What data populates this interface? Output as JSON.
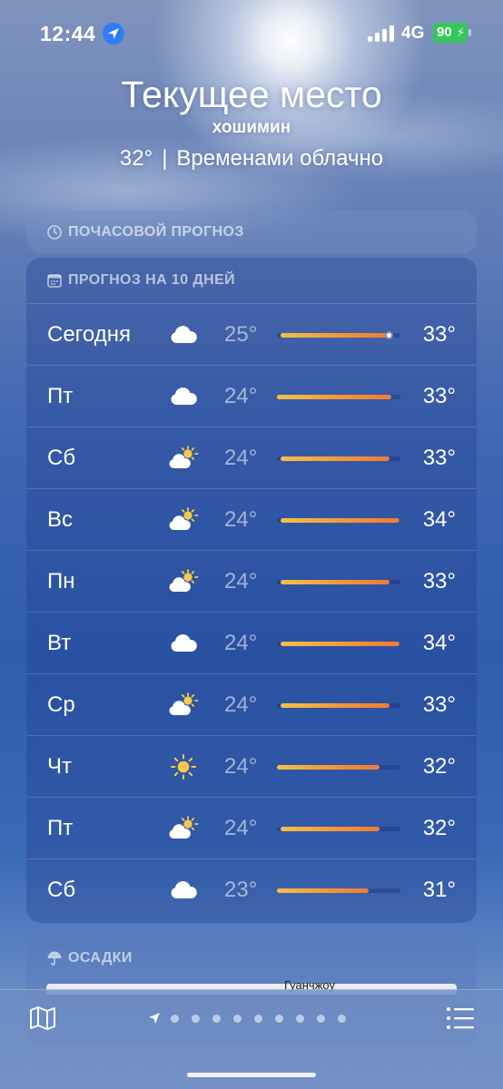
{
  "status_bar": {
    "time": "12:44",
    "network": "4G",
    "battery": "90",
    "battery_color": "#34c759"
  },
  "header": {
    "title": "Текущее место",
    "city": "хошимин",
    "temperature": "32°",
    "separator": "|",
    "condition": "Временами облачно"
  },
  "hourly_card": {
    "label": "ПОЧАСОВОЙ ПРОГНОЗ",
    "icon": "clock-icon"
  },
  "forecast_card": {
    "label": "ПРОГНОЗ НА 10 ДНЕЙ",
    "icon": "calendar-icon",
    "days": [
      {
        "day": "Сегодня",
        "icon": "cloud-icon",
        "low": "25°",
        "high": "33°",
        "range_start": 0.03,
        "range_end": 0.92,
        "current": 0.8
      },
      {
        "day": "Пт",
        "icon": "cloud-icon",
        "low": "24°",
        "high": "33°",
        "range_start": 0.0,
        "range_end": 0.93
      },
      {
        "day": "Сб",
        "icon": "partly-sunny-icon",
        "low": "24°",
        "high": "33°",
        "range_start": 0.03,
        "range_end": 0.91
      },
      {
        "day": "Вс",
        "icon": "partly-sunny-icon",
        "low": "24°",
        "high": "34°",
        "range_start": 0.03,
        "range_end": 0.99
      },
      {
        "day": "Пн",
        "icon": "partly-sunny-icon",
        "low": "24°",
        "high": "33°",
        "range_start": 0.03,
        "range_end": 0.91
      },
      {
        "day": "Вт",
        "icon": "cloud-icon",
        "low": "24°",
        "high": "34°",
        "range_start": 0.03,
        "range_end": 0.99
      },
      {
        "day": "Ср",
        "icon": "partly-sunny-icon",
        "low": "24°",
        "high": "33°",
        "range_start": 0.03,
        "range_end": 0.91
      },
      {
        "day": "Чт",
        "icon": "sun-icon",
        "low": "24°",
        "high": "32°",
        "range_start": 0.0,
        "range_end": 0.83
      },
      {
        "day": "Пт",
        "icon": "partly-sunny-icon",
        "low": "24°",
        "high": "32°",
        "range_start": 0.03,
        "range_end": 0.83
      },
      {
        "day": "Сб",
        "icon": "cloud-icon",
        "low": "23°",
        "high": "31°",
        "range_start": 0.0,
        "range_end": 0.74
      }
    ]
  },
  "precip_card": {
    "label": "ОСАДКИ",
    "icon": "umbrella-icon",
    "map_label": "Гуанчжоу"
  },
  "toolbar": {
    "map_icon": "map-icon",
    "list_icon": "list-icon",
    "page_dots": 9
  }
}
